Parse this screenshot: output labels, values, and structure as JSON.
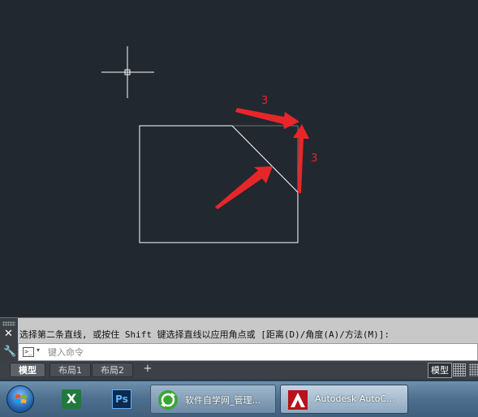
{
  "drawing": {
    "dimension_top": "3",
    "dimension_right": "3"
  },
  "command_line": {
    "history": "选择第二条直线, 或按住 Shift 键选择直线以应用角点或 [距离(D)/角度(A)/方法(M)]:",
    "input_placeholder": "键入命令",
    "close_glyph": "✕",
    "wrench_glyph": "🔧",
    "prompt_glyph": ">_",
    "dropdown_glyph": "▾"
  },
  "layout_tabs": {
    "tabs": [
      {
        "label": "模型",
        "active": true
      },
      {
        "label": "布局1",
        "active": false
      },
      {
        "label": "布局2",
        "active": false
      }
    ],
    "add_glyph": "+"
  },
  "status_bar": {
    "model_label": "模型"
  },
  "taskbar": {
    "excel_glyph": "X",
    "ps_glyph": "Ps",
    "buttons": [
      {
        "label": "软件自学网_管理...",
        "icon": "refresh-icon"
      },
      {
        "label": "Autodesk AutoC...",
        "icon": "autocad-icon"
      }
    ]
  },
  "colors": {
    "canvas_bg": "#212830",
    "annotation_red": "#e8262a",
    "line_white": "#ffffff"
  }
}
